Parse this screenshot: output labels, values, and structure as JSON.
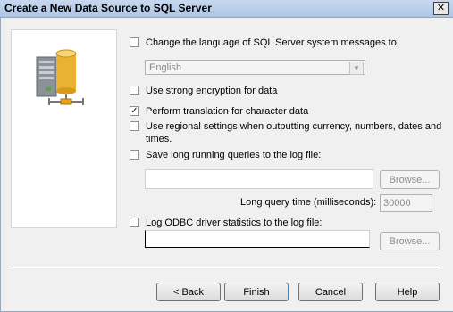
{
  "window": {
    "title": "Create a New Data Source to SQL Server",
    "close_glyph": "✕"
  },
  "options": {
    "change_language": {
      "label": "Change the language of SQL Server system messages to:",
      "checked": false
    },
    "language_select": {
      "value": "English"
    },
    "strong_encryption": {
      "label": "Use strong encryption for data",
      "checked": false
    },
    "translation": {
      "label": "Perform translation for character data",
      "checked": true,
      "mark": "✓"
    },
    "regional": {
      "label": "Use regional settings when outputting currency, numbers, dates and times.",
      "checked": false
    },
    "long_queries": {
      "label": "Save long running queries to the log file:",
      "checked": false,
      "browse_label": "Browse..."
    },
    "long_query_time": {
      "label": "Long query time (milliseconds):",
      "value": "30000"
    },
    "odbc_stats": {
      "label": "Log ODBC driver statistics to the log file:",
      "checked": false,
      "browse_label": "Browse..."
    }
  },
  "footer": {
    "back": "< Back",
    "finish": "Finish",
    "cancel": "Cancel",
    "help": "Help"
  },
  "icons": {
    "illustration": "server-database-network-icon"
  }
}
